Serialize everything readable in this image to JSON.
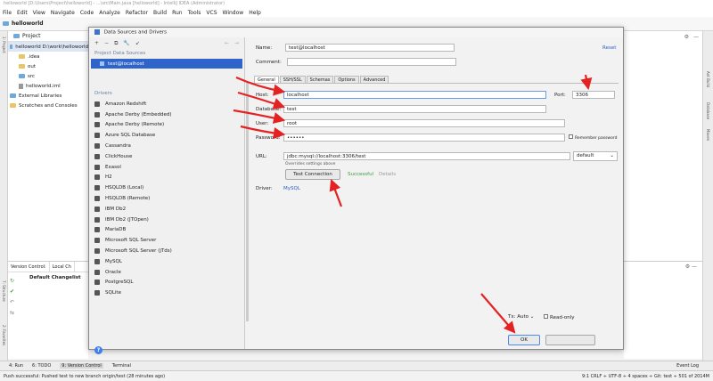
{
  "window": {
    "title": "helloworld [D:\\Users\\Project\\helloworld] - ...\\src\\Main.java [helloworld] - IntelliJ IDEA (Administrator)"
  },
  "menu": [
    "File",
    "Edit",
    "View",
    "Navigate",
    "Code",
    "Analyze",
    "Refactor",
    "Build",
    "Run",
    "Tools",
    "VCS",
    "Window",
    "Help"
  ],
  "navbar": {
    "project_name": "helloworld"
  },
  "project_panel": {
    "header": "Project",
    "tree": [
      "helloworld D:\\work\\helloworld",
      ".idea",
      "out",
      "src",
      "helloworld.iml",
      "External Libraries",
      "Scratches and Consoles"
    ]
  },
  "vc_panel": {
    "tabs": [
      "Version Control:",
      "Local Ch"
    ],
    "changelist": "Default Changelist"
  },
  "dialog": {
    "title": "Data Sources and Drivers",
    "toolbar": [
      "+",
      "−",
      "⧉",
      "🔧",
      "↙",
      "←",
      "→"
    ],
    "project_sources_label": "Project Data Sources",
    "selected_source": "test@localhost",
    "drivers_label": "Drivers",
    "drivers": [
      "Amazon Redshift",
      "Apache Derby (Embedded)",
      "Apache Derby (Remote)",
      "Azure SQL Database",
      "Cassandra",
      "ClickHouse",
      "Exasol",
      "H2",
      "HSQLDB (Local)",
      "HSQLDB (Remote)",
      "IBM Db2",
      "IBM Db2 (JTOpen)",
      "MariaDB",
      "Microsoft SQL Server",
      "Microsoft SQL Server (jTds)",
      "MySQL",
      "Oracle",
      "PostgreSQL",
      "SQLite"
    ],
    "form": {
      "name_label": "Name:",
      "name_value": "test@localhost",
      "reset_label": "Reset",
      "comment_label": "Comment:",
      "tabs": [
        "General",
        "SSH/SSL",
        "Schemas",
        "Options",
        "Advanced"
      ],
      "host_label": "Host:",
      "host_value": "localhost",
      "port_label": "Port:",
      "port_value": "3306",
      "database_label": "Database:",
      "database_value": "test",
      "user_label": "User:",
      "user_value": "root",
      "password_label": "Password:",
      "password_value": "••••••",
      "remember_label": "Remember password",
      "url_label": "URL:",
      "url_value": "jdbc:mysql://localhost:3306/test",
      "url_mode": "default",
      "url_note": "Overrides settings above",
      "test_connection_label": "Test Connection",
      "status_text": "Successful",
      "details_label": "Details",
      "driver_label": "Driver:",
      "driver_value": "MySQL"
    },
    "footer": {
      "tx_label": "Tx: Auto",
      "readonly_label": "Read-only",
      "ok_label": "OK",
      "help_icon": "?"
    }
  },
  "bottom_tabs": [
    "4: Run",
    "6: TODO",
    "9: Version Control",
    "Terminal"
  ],
  "event_log": "Event Log",
  "status": {
    "message": "Push successful: Pushed test to new branch origin/test (28 minutes ago)",
    "right": "9:1   CRLF ÷   UTF-8 ÷   4 spaces ÷   Git: test ÷   501 of 2014M"
  },
  "colors": {
    "selection": "#2f65ca",
    "arrow": "#e52222",
    "link": "#2a62c9",
    "success": "#3c9c3c"
  }
}
